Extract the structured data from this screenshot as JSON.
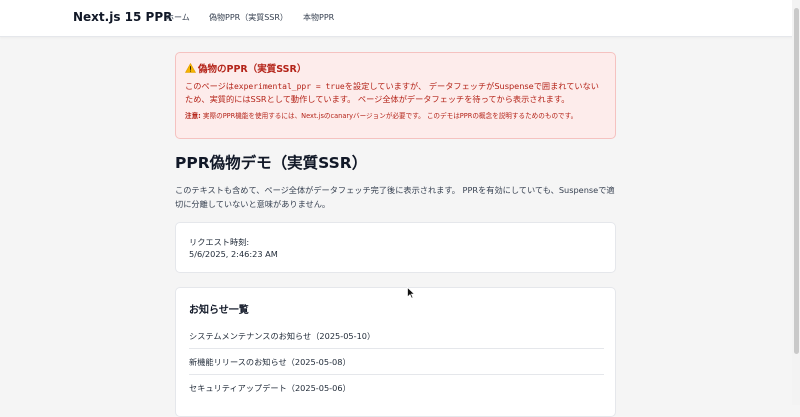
{
  "nav": {
    "brand": "Next.js 15 PPR",
    "links": [
      {
        "label": "ホーム"
      },
      {
        "label": "偽物PPR（実質SSR）"
      },
      {
        "label": "本物PPR"
      }
    ]
  },
  "alert": {
    "icon": "warning-icon",
    "title": "偽物のPPR（実質SSR）",
    "body_pre": "このページは",
    "body_code": "experimental_ppr = true",
    "body_post": "を設定していますが、 データフェッチがSuspenseで囲まれていないため、実質的にはSSRとして動作しています。 ページ全体がデータフェッチを待ってから表示されます。",
    "note_label": "注意:",
    "note_text": " 実際のPPR機能を使用するには、Next.jsのcanaryバージョンが必要です。 このデモはPPRの概念を説明するためのものです。"
  },
  "page": {
    "title": "PPR偽物デモ（実質SSR）",
    "intro": "このテキストも含めて、ページ全体がデータフェッチ完了後に表示されます。 PPRを有効にしていても、Suspenseで適切に分離していないと意味がありません。"
  },
  "request_time": {
    "label": "リクエスト時刻:",
    "value": "5/6/2025, 2:46:23 AM"
  },
  "news": {
    "heading": "お知らせ一覧",
    "items": [
      {
        "text": "システムメンテナンスのお知らせ（2025-05-10）"
      },
      {
        "text": "新機能リリースのお知らせ（2025-05-08）"
      },
      {
        "text": "セキュリティアップデート（2025-05-06）"
      }
    ]
  },
  "colors": {
    "alert_bg": "#fdeceb",
    "alert_border": "#f5c2c0",
    "alert_text": "#b42318"
  }
}
